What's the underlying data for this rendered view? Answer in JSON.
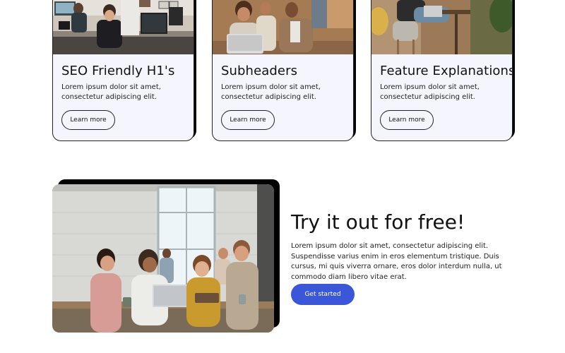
{
  "cards": [
    {
      "image": "office-team-photo",
      "title": "SEO Friendly H1's",
      "text": "Lorem ipsum dolor sit amet, consectetur adipiscing elit.",
      "button": "Learn more"
    },
    {
      "image": "laptop-colleagues-photo",
      "title": "Subheaders",
      "text": "Lorem ipsum dolor sit amet, consectetur adipiscing elit.",
      "button": "Learn more"
    },
    {
      "image": "lounge-laptop-photo",
      "title": "Feature Explanations",
      "text": "Lorem ipsum dolor sit amet, consectetur adipiscing elit.",
      "button": "Learn more"
    }
  ],
  "hero": {
    "image": "team-meeting-photo",
    "title": "Try it out for free!",
    "text": "Lorem ipsum dolor sit amet, consectetur adipiscing elit. Suspendisse varius enim in eros elementum tristique. Duis cursus, mi quis viverra ornare, eros dolor interdum nulla, ut commodo diam libero vitae erat.",
    "button": "Get started"
  },
  "colors": {
    "accent": "#3b57d9",
    "card_background": "#f5f5fd",
    "shadow": "#000000"
  }
}
